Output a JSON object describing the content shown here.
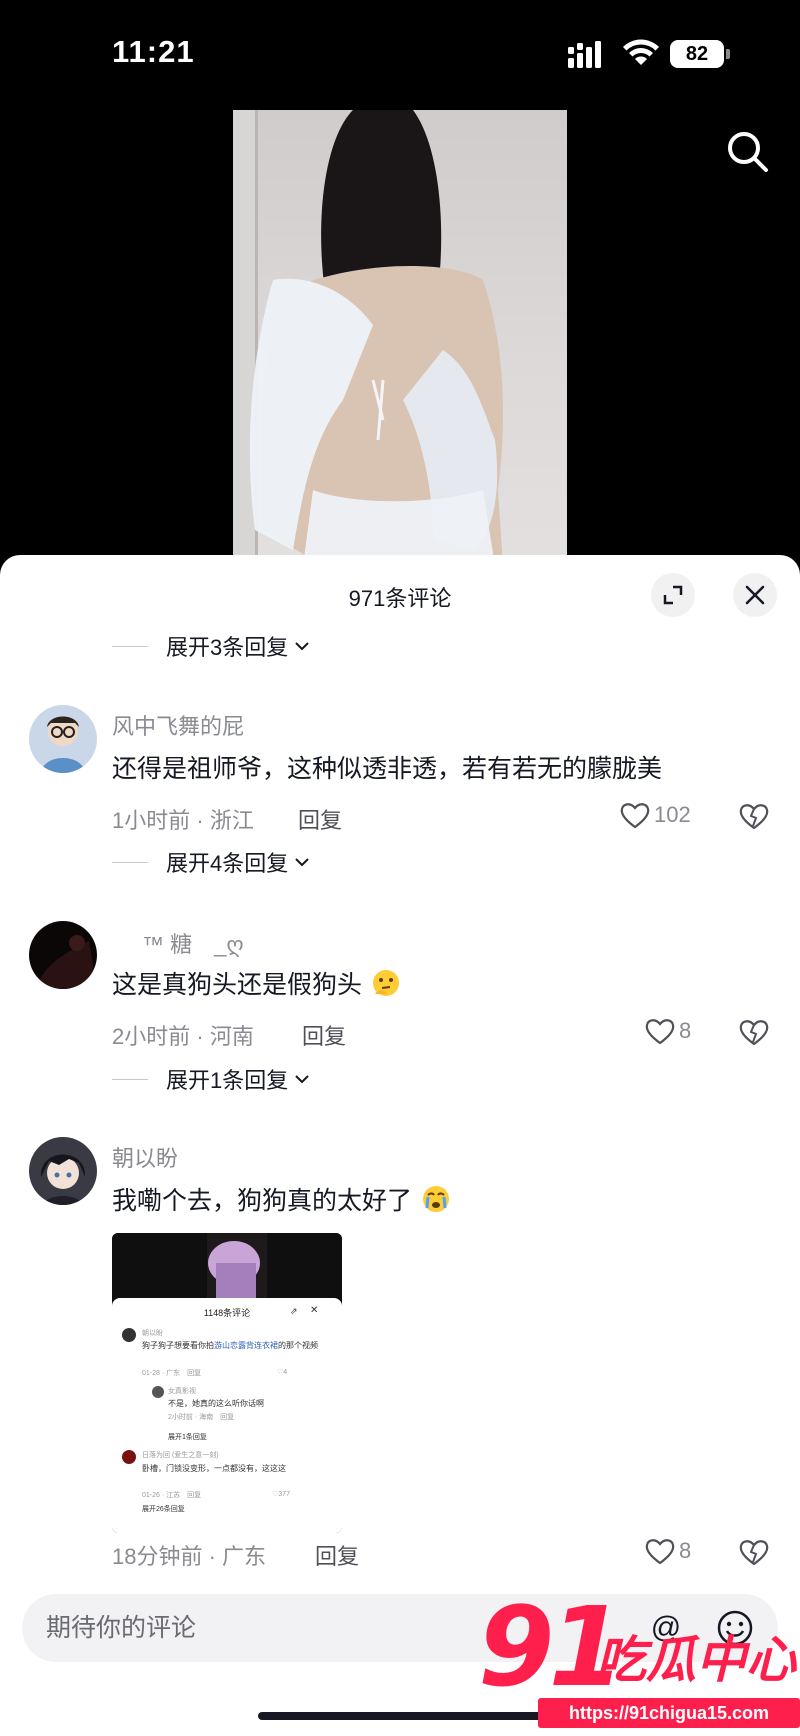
{
  "status_bar": {
    "time": "11:21",
    "battery": "82"
  },
  "comments_panel": {
    "title": "971条评论",
    "comments": [
      {
        "username": "风中飞舞的屁",
        "text": "还得是祖师爷，这种似透非透，若有若无的朦胧美",
        "time": "1小时前",
        "location": "浙江",
        "reply_label": "回复",
        "likes": "102"
      },
      {
        "username": "™ 糖　_ღ",
        "text": "这是真狗头还是假狗头",
        "emoji": "thinking-face-emoji",
        "time": "2小时前",
        "location": "河南",
        "reply_label": "回复",
        "likes": "8"
      },
      {
        "username": "朝以盼",
        "text": "我嘞个去，狗狗真的太好了",
        "emoji": "crying-face-emoji",
        "time": "18分钟前",
        "location": "广东",
        "reply_label": "回复",
        "likes": "8",
        "attachment": {
          "title": "1148条评论",
          "c1_user": "朝以盼",
          "c1_text": "狗子狗子想要看你拍",
          "c1_link": "游山恋露背连衣裙",
          "c1_tail": "的那个视频",
          "c1_meta": "01-28 · 广东　回复",
          "c1_likes": "4",
          "c2_user": "女真影视",
          "c2_text": "不是，她真的这么听你话啊",
          "c2_meta": "2小时前 · 海南　回复",
          "c2_expand": "展开1条回复",
          "c3_user": "日落为回 (爱生之意一刻)",
          "c3_text": "卧槽，门锁没变形，一点都没有，这这这",
          "c3_meta": "01-26 · 江苏　回复",
          "c3_likes": "377",
          "c3_expand": "展开26条回复"
        }
      }
    ],
    "expand_labels": [
      "展开3条回复",
      "展开4条回复",
      "展开1条回复"
    ]
  },
  "input": {
    "placeholder": "期待你的评论",
    "at_label": "@"
  },
  "watermark": {
    "number": "91",
    "text": "吃瓜中心",
    "url": "https://91chigua15.com"
  },
  "colors": {
    "accent": "#ff1f4d",
    "text": "#161823",
    "muted": "#8a8b91"
  }
}
